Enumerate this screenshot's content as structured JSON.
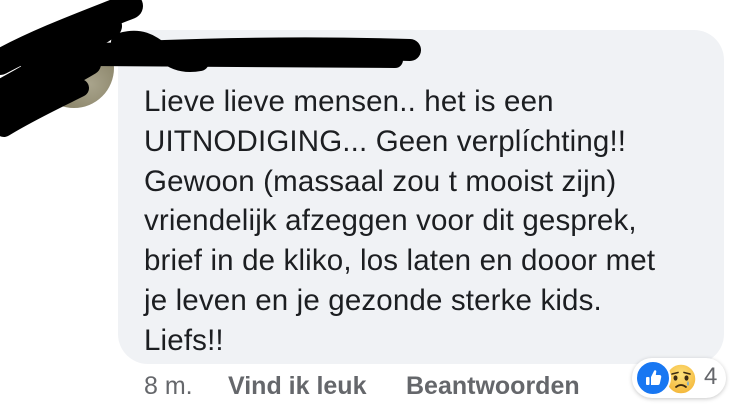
{
  "comment": {
    "author_name": "",
    "lines": [
      "Lieve lieve mensen.. het is een",
      "UITNODIGING... Geen verplíchting!!",
      "Gewoon (massaal zou t mooist zijn)",
      "vriendelijk afzeggen voor dit gesprek,",
      "brief in de kliko, los laten en dooor met",
      "je leven en je gezonde sterke kids.",
      "Liefs!!"
    ]
  },
  "actions": {
    "time": "8 m.",
    "like_label": "Vind ik leuk",
    "reply_label": "Beantwoorden"
  },
  "reactions": {
    "icons": [
      "like-icon",
      "sad-icon"
    ],
    "count": "4"
  },
  "colors": {
    "bubble": "#f0f2f5",
    "text": "#1c1e21",
    "secondary": "#65676b",
    "like_blue": "#1877f2",
    "sad_yellow": "#f7c84a"
  }
}
